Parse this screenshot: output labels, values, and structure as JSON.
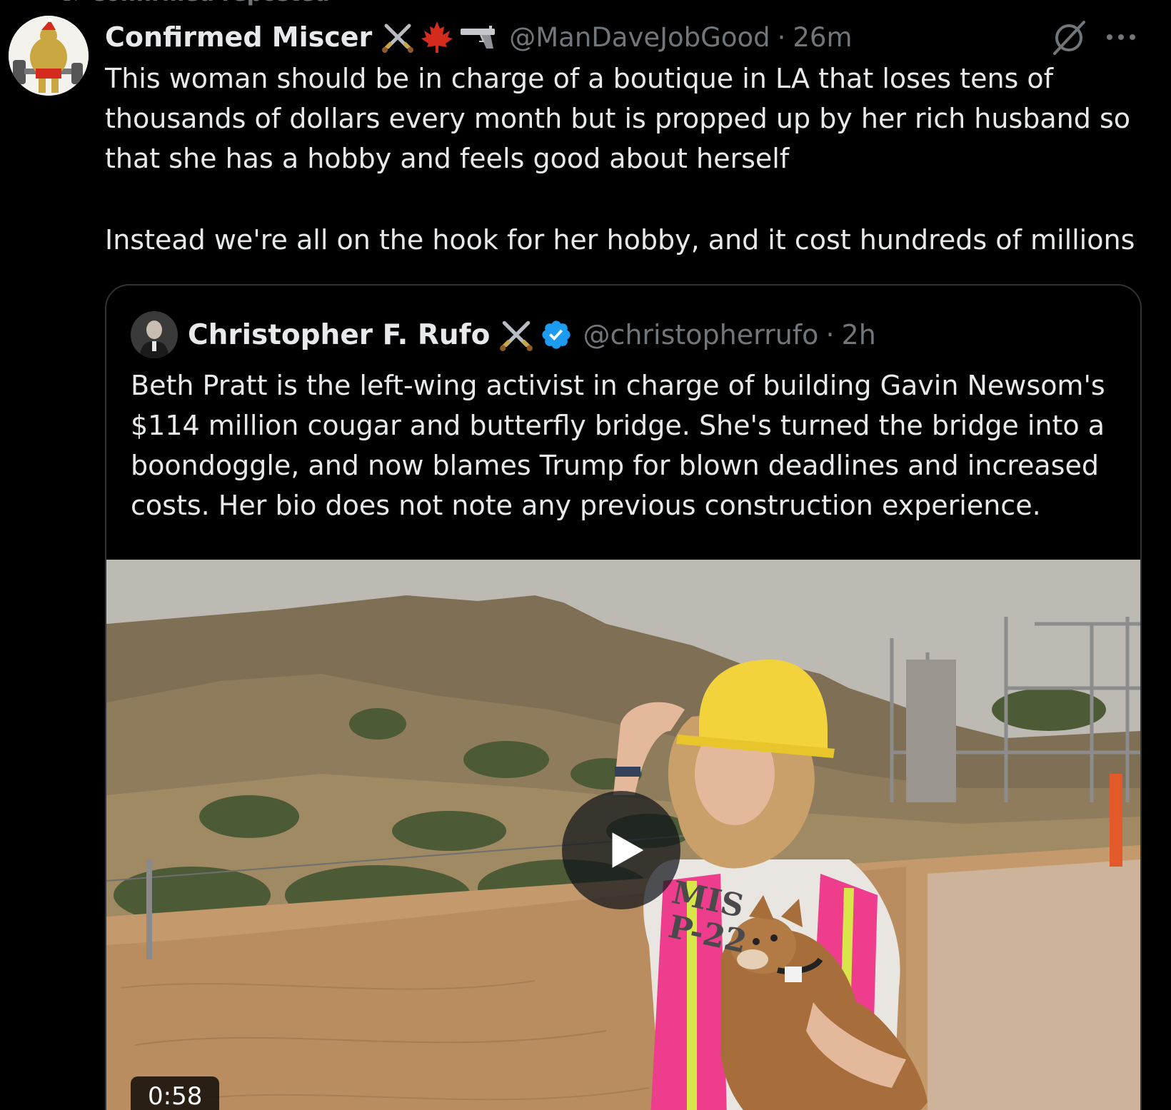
{
  "repost": {
    "label": "Confirmed reposted"
  },
  "tweet": {
    "author": {
      "display_name": "Confirmed Miscer",
      "handle": "@ManDaveJobGood",
      "badges": [
        "crossed-swords-icon",
        "maple-leaf-icon",
        "pistol-icon"
      ]
    },
    "separator": "·",
    "time": "26m",
    "text_paragraph_1": "This woman should be in charge of a boutique in LA that loses tens of thousands of dollars every month but is propped up by her rich husband so that she has a hobby and feels good about herself",
    "text_paragraph_2": "Instead we're all on the hook for her hobby, and it cost hundreds of millions"
  },
  "quote": {
    "author": {
      "display_name": "Christopher F. Rufo",
      "handle": "@christopherrufo",
      "badges": [
        "crossed-swords-icon",
        "verified-badge-icon"
      ]
    },
    "separator": "·",
    "time": "2h",
    "text": "Beth Pratt is the left-wing activist in charge of building Gavin Newsom's $114 million cougar and butterfly bridge. She's turned the bridge into a boondoggle, and now blames Trump for blown deadlines and increased costs. Her bio does not note any previous construction experience.",
    "video": {
      "duration": "0:58",
      "shirt_text_1": "MIS",
      "shirt_text_2": "P-22"
    }
  },
  "colors": {
    "background": "#000000",
    "text_primary": "#e7e9ea",
    "text_secondary": "#71767b",
    "border": "#2f3336",
    "verified_blue": "#1d9bf0",
    "maple_red": "#d52b1e"
  }
}
